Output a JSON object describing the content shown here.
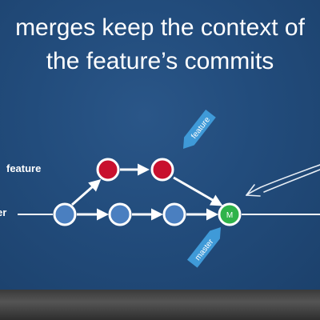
{
  "slide": {
    "title_line1": "merges keep the context of",
    "title_line2": "the feature’s commits"
  },
  "branches": {
    "feature_label": "feature",
    "master_label": "er"
  },
  "tags": {
    "feature_tag": "feature",
    "master_tag": "master"
  },
  "merge_commit_label": "M",
  "colors": {
    "background": "#224c7c",
    "feature_commit": "#c8102e",
    "master_commit": "#4a7fc0",
    "merge_commit": "#2fb34a",
    "tag": "#3f9ad8",
    "line": "#ffffff"
  }
}
